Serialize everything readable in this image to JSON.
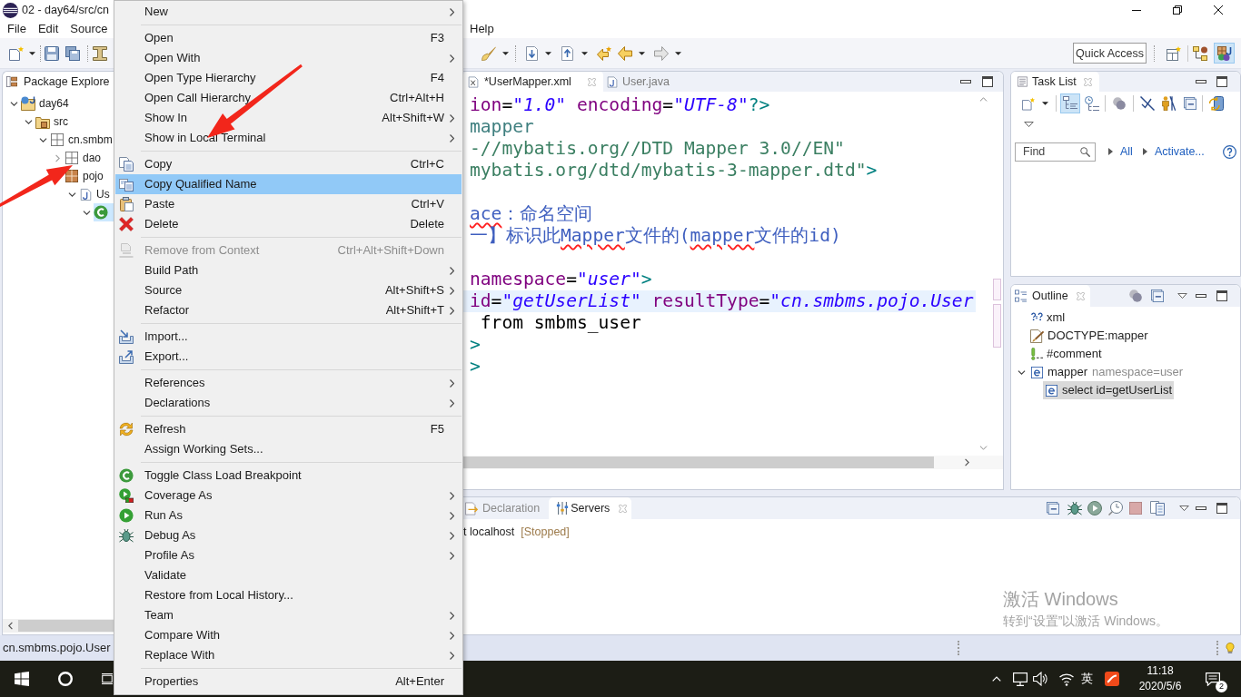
{
  "window": {
    "title": "02 - day64/src/cn"
  },
  "menu_bar": [
    "File",
    "Edit",
    "Source",
    "Help"
  ],
  "toolbar": {
    "quick_access": {
      "placeholder": "Quick Access"
    },
    "perspectives": [
      {
        "selected": false
      },
      {
        "selected": true
      }
    ]
  },
  "package_explorer": {
    "title": "Package Explore",
    "tree": [
      {
        "label": "day64",
        "kind": "project",
        "expanded": true,
        "selected": false,
        "children": [
          {
            "label": "src",
            "kind": "srcfolder",
            "expanded": true,
            "selected": false,
            "children": [
              {
                "label": "cn.smbm",
                "kind": "emptypackage",
                "expanded": true,
                "selected": false,
                "children": [
                  {
                    "label": "dao",
                    "kind": "emptypackage",
                    "expanded": false,
                    "selected": false
                  },
                  {
                    "label": "pojo",
                    "kind": "package",
                    "selected": false,
                    "children": [
                      {
                        "label": "Us",
                        "kind": "javafile",
                        "expanded": true,
                        "selected": false,
                        "children": [
                          {
                            "kind": "class",
                            "expanded": true,
                            "selected": true
                          }
                        ]
                      }
                    ]
                  }
                ]
              }
            ]
          }
        ]
      }
    ]
  },
  "context_menu": {
    "groups": [
      [
        {
          "label": "New",
          "submenu": true,
          "disabled": false,
          "selected": false
        }
      ],
      [
        {
          "label": "Open",
          "shortcut": "F3",
          "submenu": false,
          "disabled": false,
          "selected": false
        },
        {
          "label": "Open With",
          "submenu": true,
          "disabled": false,
          "selected": false
        },
        {
          "label": "Open Type Hierarchy",
          "shortcut": "F4",
          "submenu": false,
          "disabled": false,
          "selected": false
        },
        {
          "label": "Open Call Hierarchy",
          "shortcut": "Ctrl+Alt+H",
          "submenu": false,
          "disabled": false,
          "selected": false
        },
        {
          "label": "Show In",
          "shortcut": "Alt+Shift+W",
          "submenu": true,
          "disabled": false,
          "selected": false
        },
        {
          "label": "Show in Local Terminal",
          "submenu": true,
          "disabled": false,
          "selected": false
        }
      ],
      [
        {
          "label": "Copy",
          "shortcut": "Ctrl+C",
          "submenu": false,
          "disabled": false,
          "selected": false
        },
        {
          "label": "Copy Qualified Name",
          "submenu": false,
          "disabled": false,
          "selected": true
        },
        {
          "label": "Paste",
          "shortcut": "Ctrl+V",
          "submenu": false,
          "disabled": false,
          "selected": false
        },
        {
          "label": "Delete",
          "shortcut": "Delete",
          "submenu": false,
          "disabled": false,
          "selected": false
        }
      ],
      [
        {
          "label": "Remove from Context",
          "shortcut": "Ctrl+Alt+Shift+Down",
          "submenu": false,
          "disabled": true,
          "selected": false
        },
        {
          "label": "Build Path",
          "submenu": true,
          "disabled": false,
          "selected": false
        },
        {
          "label": "Source",
          "shortcut": "Alt+Shift+S",
          "submenu": true,
          "disabled": false,
          "selected": false
        },
        {
          "label": "Refactor",
          "shortcut": "Alt+Shift+T",
          "submenu": true,
          "disabled": false,
          "selected": false
        }
      ],
      [
        {
          "label": "Import...",
          "submenu": false,
          "disabled": false,
          "selected": false
        },
        {
          "label": "Export...",
          "submenu": false,
          "disabled": false,
          "selected": false
        }
      ],
      [
        {
          "label": "References",
          "submenu": true,
          "disabled": false,
          "selected": false
        },
        {
          "label": "Declarations",
          "submenu": true,
          "disabled": false,
          "selected": false
        }
      ],
      [
        {
          "label": "Refresh",
          "shortcut": "F5",
          "submenu": false,
          "disabled": false,
          "selected": false
        },
        {
          "label": "Assign Working Sets...",
          "submenu": false,
          "disabled": false,
          "selected": false
        }
      ],
      [
        {
          "label": "Toggle Class Load Breakpoint",
          "submenu": false,
          "disabled": false,
          "selected": false
        },
        {
          "label": "Coverage As",
          "submenu": true,
          "disabled": false,
          "selected": false
        },
        {
          "label": "Run As",
          "submenu": true,
          "disabled": false,
          "selected": false
        },
        {
          "label": "Debug As",
          "submenu": true,
          "disabled": false,
          "selected": false
        },
        {
          "label": "Profile As",
          "submenu": true,
          "disabled": false,
          "selected": false
        },
        {
          "label": "Validate",
          "submenu": false,
          "disabled": false,
          "selected": false
        },
        {
          "label": "Restore from Local History...",
          "submenu": false,
          "disabled": false,
          "selected": false
        },
        {
          "label": "Team",
          "submenu": true,
          "disabled": false,
          "selected": false
        },
        {
          "label": "Compare With",
          "submenu": true,
          "disabled": false,
          "selected": false
        },
        {
          "label": "Replace With",
          "submenu": true,
          "disabled": false,
          "selected": false
        }
      ],
      [
        {
          "label": "Properties",
          "shortcut": "Alt+Enter",
          "submenu": false,
          "disabled": false,
          "selected": false
        }
      ]
    ]
  },
  "editor": {
    "tabs": [
      {
        "label": "*UserMapper.xml",
        "kind": "xml",
        "selected": true
      },
      {
        "label": "User.java",
        "kind": "java",
        "selected": false
      }
    ],
    "lines": [
      {
        "current": false,
        "segments": [
          {
            "kind": "attr",
            "text": "ion"
          },
          {
            "kind": "eq",
            "text": "="
          },
          {
            "kind": "value",
            "text": "\"1.0\""
          },
          {
            "kind": "attr",
            "text": " encoding"
          },
          {
            "kind": "eq",
            "text": "="
          },
          {
            "kind": "value",
            "text": "\"UTF-8\""
          },
          {
            "kind": "tag",
            "text": "?>"
          }
        ]
      },
      {
        "current": false,
        "segments": [
          {
            "kind": "doctype",
            "text": "mapper"
          }
        ]
      },
      {
        "current": false,
        "segments": [
          {
            "kind": "reference",
            "text": "-//mybatis.org//DTD Mapper 3.0//EN\""
          }
        ]
      },
      {
        "current": false,
        "segments": [
          {
            "kind": "reference",
            "text": "mybatis.org/dtd/mybatis-3-mapper.dtd\""
          },
          {
            "kind": "tag",
            "text": ">"
          }
        ]
      },
      {
        "current": false
      },
      {
        "current": false,
        "segments": [
          {
            "kind": "comment",
            "text": "ace",
            "misspelled": true
          },
          {
            "kind": "comment",
            "text": "：命名空间",
            "misspelled": false
          }
        ]
      },
      {
        "current": false,
        "segments": [
          {
            "kind": "comment",
            "text": "一】标识此",
            "misspelled": false
          },
          {
            "kind": "comment",
            "text": "Mapper",
            "misspelled": true
          },
          {
            "kind": "comment",
            "text": "文件的(",
            "misspelled": false
          },
          {
            "kind": "comment",
            "text": "mapper",
            "misspelled": true
          },
          {
            "kind": "comment",
            "text": "文件的id)",
            "misspelled": false
          }
        ]
      },
      {
        "current": false
      },
      {
        "current": false,
        "segments": [
          {
            "kind": "attr",
            "text": "namespace"
          },
          {
            "kind": "eq",
            "text": "="
          },
          {
            "kind": "value",
            "text": "\"user\""
          },
          {
            "kind": "tag",
            "text": ">"
          }
        ]
      },
      {
        "current": true,
        "segments": [
          {
            "kind": "attr",
            "text": "id"
          },
          {
            "kind": "eq",
            "text": "="
          },
          {
            "kind": "value",
            "text": "\"getUserList\""
          },
          {
            "kind": "attr",
            "text": " resultType"
          },
          {
            "kind": "eq",
            "text": "="
          },
          {
            "kind": "value",
            "text": "\"cn.smbms.pojo.User"
          }
        ]
      },
      {
        "current": false,
        "segments": [
          {
            "kind": "plain",
            "text": " from smbms_user"
          }
        ]
      },
      {
        "current": false,
        "segments": [
          {
            "kind": "tag",
            "text": ">"
          }
        ]
      },
      {
        "current": false,
        "segments": [
          {
            "kind": "tag",
            "text": ">"
          }
        ]
      }
    ]
  },
  "task_list": {
    "title": "Task List",
    "view_modes": [
      {
        "selected": true
      },
      {
        "selected": false
      }
    ],
    "find": {
      "placeholder": "Find"
    },
    "links": [
      "All",
      "Activate..."
    ]
  },
  "outline": {
    "title": "Outline",
    "tree": [
      {
        "label": "xml",
        "kind": "pi",
        "selected": false
      },
      {
        "label": "DOCTYPE:mapper",
        "kind": "doctype",
        "selected": false
      },
      {
        "label": "#comment",
        "kind": "comment",
        "selected": false
      },
      {
        "label": "mapper",
        "detail": "namespace=user",
        "kind": "element",
        "expanded": true,
        "selected": false,
        "children": [
          {
            "label": "select id=getUserList",
            "kind": "element",
            "selected": true
          }
        ]
      }
    ]
  },
  "bottom_panel": {
    "tabs": [
      {
        "label": "Declaration",
        "kind": "declaration",
        "selected": false
      },
      {
        "label": "Servers",
        "kind": "servers",
        "selected": true
      }
    ],
    "servers": [
      {
        "name": "t localhost",
        "state": "[Stopped]"
      }
    ]
  },
  "status_bar": {
    "selection": "cn.smbms.pojo.User"
  },
  "taskbar": {
    "input_mode": "英",
    "time": "11:18",
    "date": "2020/5/6",
    "notification_count": "2"
  },
  "activation_notice": {
    "title": "激活 Windows",
    "message": "转到“设置”以激活 Windows。"
  }
}
